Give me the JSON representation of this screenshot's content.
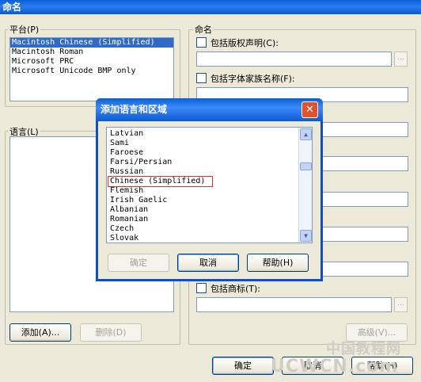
{
  "window": {
    "title": "命名"
  },
  "platform": {
    "label": "平台(P)",
    "items": [
      "Macintosh Chinese (Simplified)",
      "Macintosh Roman",
      "Microsoft PRC",
      "Microsoft Unicode BMP only"
    ],
    "selected_index": 0
  },
  "language": {
    "label": "语言(L)"
  },
  "buttons": {
    "add": "添加(A)...",
    "delete": "删除(D)",
    "advanced": "高级(V)...",
    "ok": "确定",
    "cancel": "取消",
    "help": "帮助(H)"
  },
  "naming": {
    "label": "命名",
    "copyright": "包括版权声明(C):",
    "family": "包括字体家族名称(F):",
    "trademark": "包括商标(T):",
    "ellipsis": "..."
  },
  "modal": {
    "title": "添加语言和区域",
    "items": [
      "Latvian",
      "Sami",
      "Faroese",
      "Farsi/Persian",
      "Russian",
      "Chinese (Simplified)",
      "Flemish",
      "Irish Gaelic",
      "Albanian",
      "Romanian",
      "Czech",
      "Slovak"
    ],
    "highlighted_index": 5,
    "ok": "确定",
    "cancel": "取消",
    "help": "帮助(H)",
    "close": "✕"
  },
  "watermark": {
    "line1": "中国教程网",
    "line2": "UCWCN.com"
  }
}
